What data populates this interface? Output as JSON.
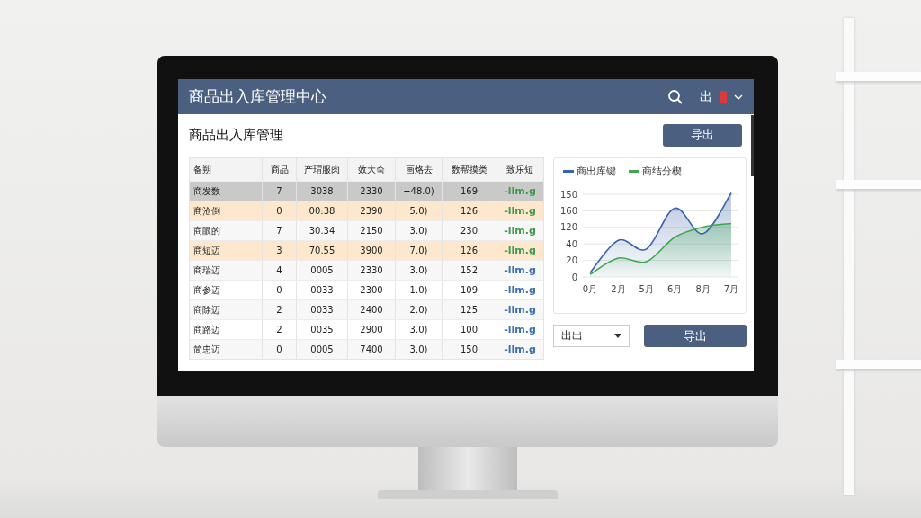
{
  "window": {
    "title": "商品出入库管理中心",
    "user_label": "出"
  },
  "page": {
    "title": "商品出入库管理",
    "export_button": "导出"
  },
  "table": {
    "columns": [
      "备朔",
      "商品",
      "产瑁服肉",
      "效大숙",
      "画烙去",
      "数帮摸类",
      "致乐短"
    ],
    "rows": [
      {
        "cells": [
          "商发数",
          "7",
          "3038",
          "2330",
          "+48.0)",
          "169",
          "-llm.g"
        ],
        "selected": true,
        "flagged": false,
        "color": "#3f9a4a"
      },
      {
        "cells": [
          "商沧倒",
          "0",
          "00:38",
          "2390",
          "5.0)",
          "126",
          "-llm.g"
        ],
        "selected": false,
        "flagged": true,
        "color": "#3f9a4a"
      },
      {
        "cells": [
          "商眼的",
          "7",
          "30.34",
          "2150",
          "3.0)",
          "230",
          "-llm.g"
        ],
        "selected": false,
        "flagged": false,
        "color": "#3f9a4a"
      },
      {
        "cells": [
          "商短迈",
          "3",
          "70.55",
          "3900",
          "7.0)",
          "126",
          "-llm.g"
        ],
        "selected": false,
        "flagged": true,
        "color": "#3f9a4a"
      },
      {
        "cells": [
          "商瑞迈",
          "4",
          "0005",
          "2330",
          "3.0)",
          "152",
          "-llm.g"
        ],
        "selected": false,
        "flagged": false,
        "color": "#3a6fb0"
      },
      {
        "cells": [
          "商参迈",
          "0",
          "0033",
          "2300",
          "1.0)",
          "109",
          "-llm.g"
        ],
        "selected": false,
        "flagged": false,
        "color": "#3a6fb0"
      },
      {
        "cells": [
          "商除迈",
          "2",
          "0033",
          "2400",
          "2.0)",
          "125",
          "-llm.g"
        ],
        "selected": false,
        "flagged": false,
        "color": "#3a6fb0"
      },
      {
        "cells": [
          "商路迈",
          "2",
          "0035",
          "2900",
          "3.0)",
          "100",
          "-llm.g"
        ],
        "selected": false,
        "flagged": false,
        "color": "#3a6fb0"
      },
      {
        "cells": [
          "简忠迈",
          "0",
          "0005",
          "7400",
          "3.0)",
          "150",
          "-llm.g"
        ],
        "selected": false,
        "flagged": false,
        "color": "#3a6fb0"
      }
    ]
  },
  "chart": {
    "legend": [
      {
        "name": "商出库键",
        "color": "#3a62a8"
      },
      {
        "name": "商结分楔",
        "color": "#3fa653"
      }
    ],
    "y_labels": [
      "150",
      "160",
      "120",
      "40",
      "20",
      "0"
    ],
    "x_labels": [
      "0月",
      "2月",
      "5月",
      "6月",
      "8月",
      "7月"
    ]
  },
  "controls": {
    "dropdown_value": "出出",
    "export_button": "导出"
  }
}
